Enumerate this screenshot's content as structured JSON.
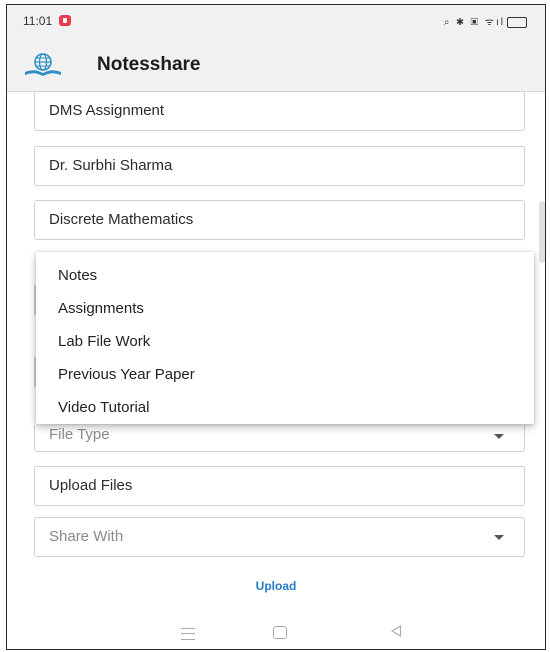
{
  "status_bar": {
    "time": "11:01",
    "icons": "⌕ ✱ ▣ ᯤıl"
  },
  "app_bar": {
    "title": "Notesshare"
  },
  "form": {
    "title_value": "DMS Assignment",
    "teacher_value": "Dr. Surbhi Sharma",
    "subject_value": "Discrete Mathematics",
    "file_type_placeholder": "File Type",
    "upload_files_placeholder": "Upload Files",
    "share_with_placeholder": "Share With",
    "upload_label": "Upload"
  },
  "dropdown": {
    "options": [
      "Notes",
      "Assignments",
      "Lab File Work",
      "Previous Year Paper",
      "Video Tutorial"
    ]
  },
  "colors": {
    "accent": "#2979c9",
    "notification": "#e83b4e",
    "bar_bg": "#f1f1f1"
  },
  "icons": {
    "logo": "globe-book-icon",
    "nav": [
      "menu-icon",
      "home-icon",
      "back-icon"
    ]
  }
}
